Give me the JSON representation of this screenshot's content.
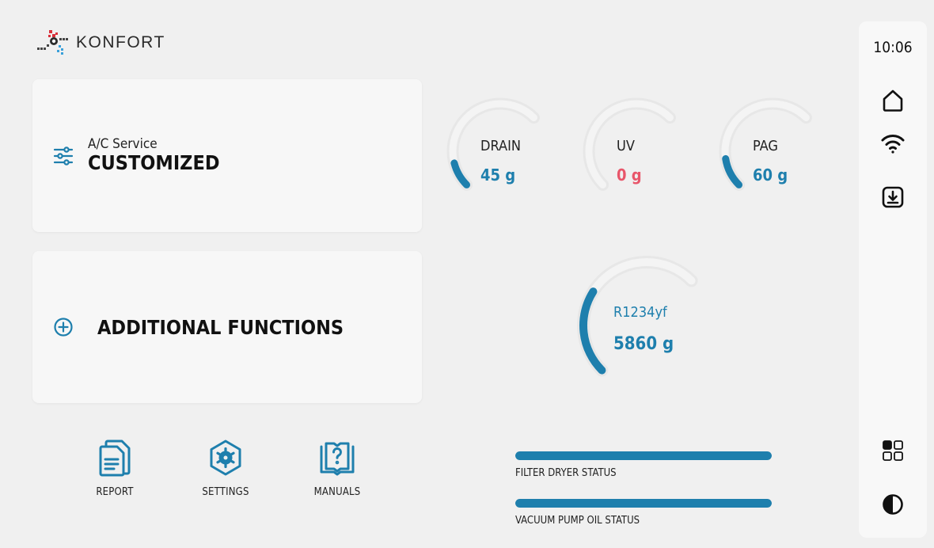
{
  "brand": {
    "name": "KONFORT"
  },
  "cards": {
    "service": {
      "subtitle": "A/C Service",
      "title": "CUSTOMIZED",
      "icon": "sliders-icon"
    },
    "additional": {
      "title": "ADDITIONAL FUNCTIONS",
      "icon": "plus-circle-icon"
    }
  },
  "gauges": [
    {
      "id": "drain",
      "label": "DRAIN",
      "value": "45 g",
      "value_color": "#1e7fad",
      "level": 0.17
    },
    {
      "id": "uv",
      "label": "UV",
      "value": "0 g",
      "value_color": "#e8566a",
      "level": 0
    },
    {
      "id": "pag",
      "label": "PAG",
      "value": "60 g",
      "value_color": "#1e7fad",
      "level": 0.2
    },
    {
      "id": "refrigerant",
      "label": "R1234yf",
      "value": "5860 g",
      "value_color": "#1e7fad",
      "level": 0.43
    }
  ],
  "bottom_buttons": [
    {
      "label": "REPORT",
      "icon": "report-icon"
    },
    {
      "label": "SETTINGS",
      "icon": "settings-icon"
    },
    {
      "label": "MANUALS",
      "icon": "manuals-icon"
    }
  ],
  "status_bars": [
    {
      "label": "FILTER DRYER STATUS",
      "level": 1.0
    },
    {
      "label": "VACUUM PUMP OIL STATUS",
      "level": 1.0
    }
  ],
  "sidebar": {
    "time": "10:06",
    "icons": [
      "home-icon",
      "wifi-icon",
      "download-icon",
      "grid-view-icon",
      "contrast-icon"
    ]
  },
  "colors": {
    "accent": "#1e7fad",
    "warning": "#e8566a",
    "background": "#f0f0f0",
    "card": "#f7f7f7"
  }
}
